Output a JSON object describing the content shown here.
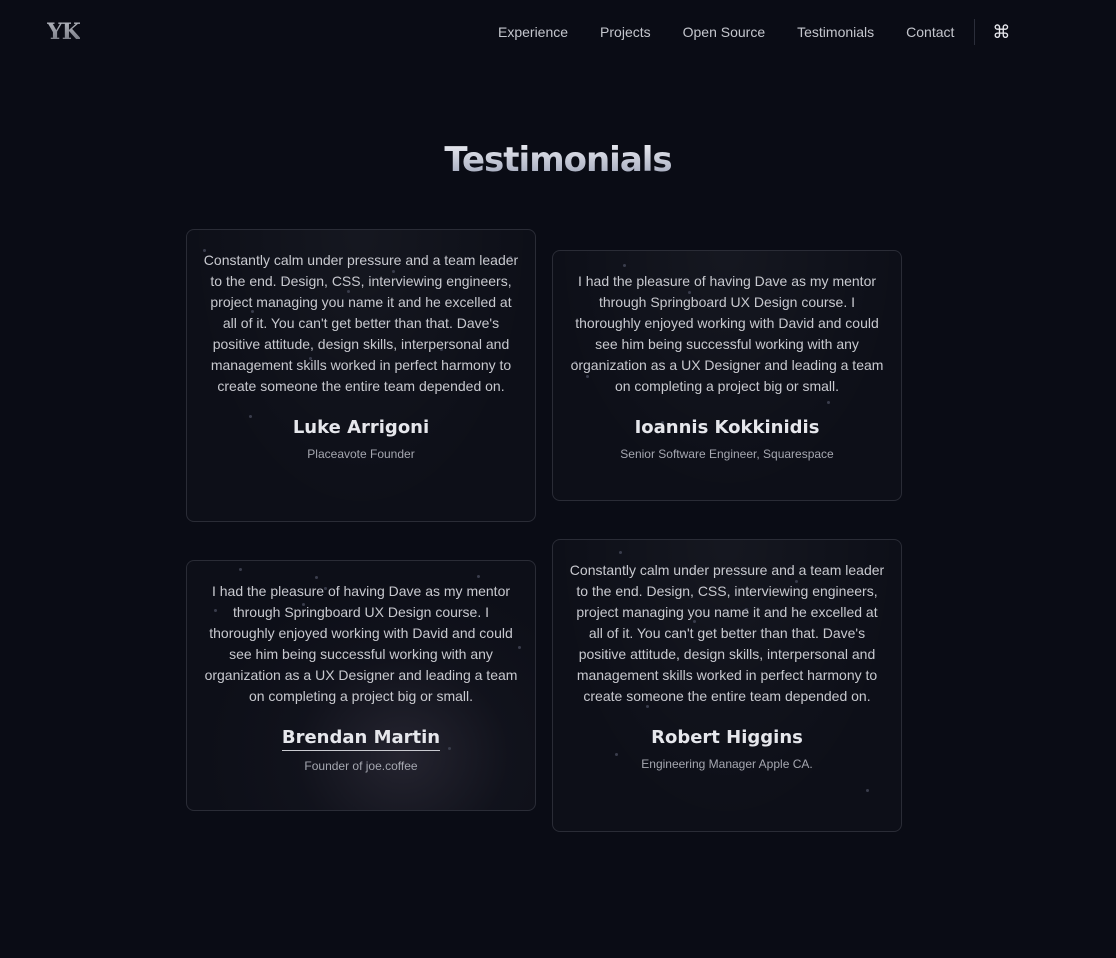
{
  "header": {
    "logo": "YK",
    "nav": [
      {
        "label": "Experience"
      },
      {
        "label": "Projects"
      },
      {
        "label": "Open Source"
      },
      {
        "label": "Testimonials"
      },
      {
        "label": "Contact"
      }
    ],
    "command_glyph": "⌘",
    "command_icon": "command-key-icon"
  },
  "section": {
    "title": "Testimonials"
  },
  "testimonials": [
    {
      "text": "Constantly calm under pressure and a team leader to the end. Design, CSS, interviewing engineers, project managing you name it and he excelled at all of it. You can't get better than that. Dave's positive attitude, design skills, interpersonal and management skills worked in perfect harmony to create someone the entire team depended on.",
      "name": "Luke Arrigoni",
      "role": "Placeavote Founder"
    },
    {
      "text": "I had the pleasure of having Dave as my mentor through Springboard UX Design course. I thoroughly enjoyed working with David and could see him being successful working with any organization as a UX Designer and leading a team on completing a project big or small.",
      "name": "Ioannis Kokkinidis",
      "role": "Senior Software Engineer, Squarespace"
    },
    {
      "text": "I had the pleasure of having Dave as my mentor through Springboard UX Design course. I thoroughly enjoyed working with David and could see him being successful working with any organization as a UX Designer and leading a team on completing a project big or small.",
      "name": "Brendan Martin",
      "role": "Founder of joe.coffee"
    },
    {
      "text": "Constantly calm under pressure and a team leader to the end. Design, CSS, interviewing engineers, project managing you name it and he excelled at all of it. You can't get better than that. Dave's positive attitude, design skills, interpersonal and management skills worked in perfect harmony to create someone the entire team depended on.",
      "name": "Robert Higgins",
      "role": "Engineering Manager Apple CA."
    }
  ],
  "colors": {
    "background": "#0a0c15",
    "card_border": "#2a2c36",
    "text": "#c8c9cf"
  }
}
